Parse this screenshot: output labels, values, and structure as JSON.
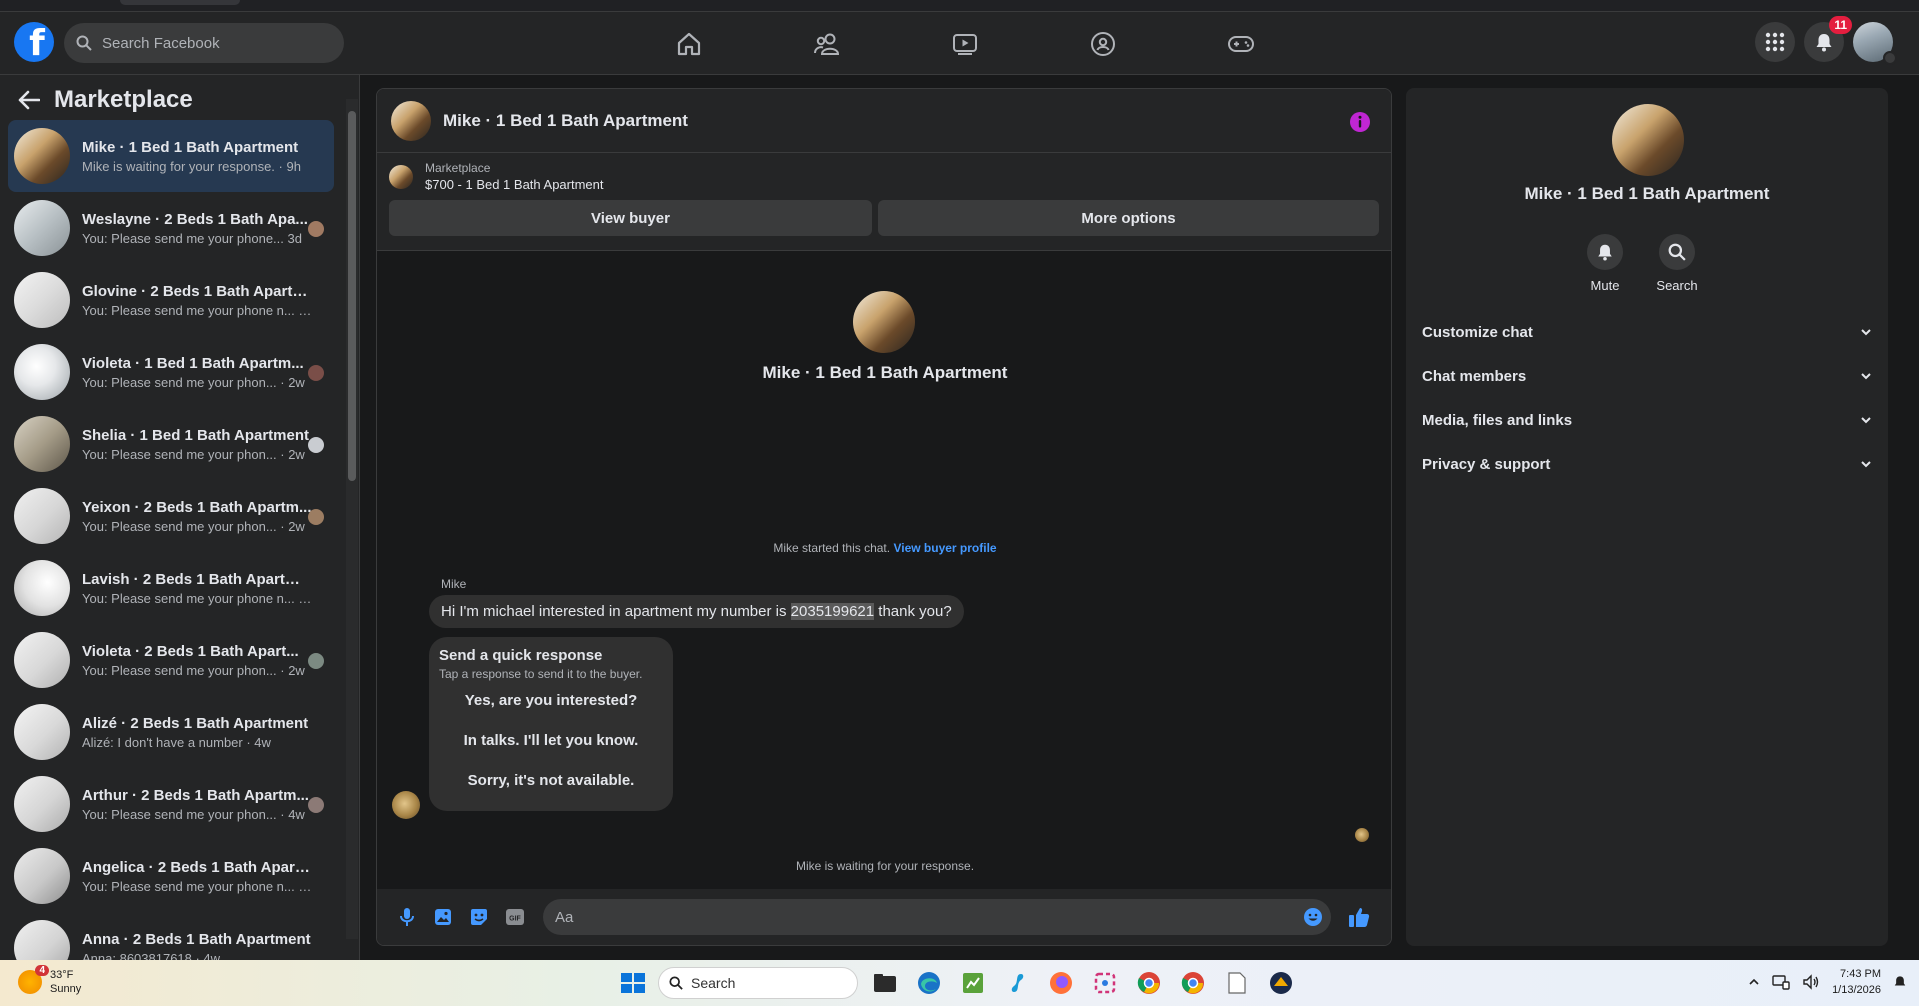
{
  "topnav": {
    "logo_letter": "f",
    "search_placeholder": "Search Facebook",
    "notifications_count": "11"
  },
  "sidebar": {
    "title": "Marketplace",
    "conversations": [
      {
        "title": "Mike · 1 Bed 1 Bath Apartment",
        "subtitle": "Mike is waiting for your response. · 9h",
        "active": true
      },
      {
        "title": "Weslayne · 2 Beds 1 Bath Apa...",
        "subtitle": "You: Please send me your phone... 3d"
      },
      {
        "title": "Glovine · 2 Beds 1 Bath Apartme...",
        "subtitle": "You: Please send me your phone n... · 2w"
      },
      {
        "title": "Violeta · 1 Bed 1 Bath Apartm...",
        "subtitle": "You: Please send me your phon... · 2w"
      },
      {
        "title": "Shelia · 1 Bed 1 Bath Apartment",
        "subtitle": "You: Please send me your phon... · 2w"
      },
      {
        "title": "Yeixon · 2 Beds 1 Bath Apartm...",
        "subtitle": "You: Please send me your phon... · 2w"
      },
      {
        "title": "Lavish · 2 Beds 1 Bath Apartment",
        "subtitle": "You: Please send me your phone n... · 2w"
      },
      {
        "title": "Violeta · 2 Beds 1 Bath Apart...",
        "subtitle": "You: Please send me your phon... · 2w"
      },
      {
        "title": "Alizé · 2 Beds 1 Bath Apartment",
        "subtitle": "Alizé: I don't have a number · 4w"
      },
      {
        "title": "Arthur · 2 Beds 1 Bath Apartm...",
        "subtitle": "You: Please send me your phon... · 4w"
      },
      {
        "title": "Angelica · 2 Beds 1 Bath Apartm...",
        "subtitle": "You: Please send me your phone n... · 4w"
      },
      {
        "title": "Anna · 2 Beds 1 Bath Apartment",
        "subtitle": "Anna: 8603817618 · 4w"
      }
    ]
  },
  "chat": {
    "header_name": "Mike · 1 Bed 1 Bath Apartment",
    "listing_category": "Marketplace",
    "listing_price": "$700 - 1 Bed 1 Bath Apartment",
    "view_buyer_label": "View buyer",
    "more_options_label": "More options",
    "intro_name": "Mike · 1 Bed 1 Bath Apartment",
    "started_text": "Mike started this chat.",
    "view_profile_link": "View buyer profile",
    "sender_name": "Mike",
    "message_before": "Hi I'm michael interested in apartment my number is ",
    "message_number": "2035199621",
    "message_after": "  thank you?",
    "quick_title": "Send a quick response",
    "quick_subtitle": "Tap a response to send it to the buyer.",
    "quick_options": [
      "Yes, are you interested?",
      "In talks. I'll let you know.",
      "Sorry, it's not available."
    ],
    "waiting_text": "Mike is waiting for your response.",
    "composer_placeholder": "Aa"
  },
  "right_panel": {
    "name": "Mike · 1 Bed 1 Bath Apartment",
    "mute_label": "Mute",
    "search_label": "Search",
    "sections": [
      "Customize chat",
      "Chat members",
      "Media, files and links",
      "Privacy & support"
    ]
  },
  "taskbar": {
    "weather_badge": "4",
    "temperature": "33°F",
    "condition": "Sunny",
    "search_label": "Search",
    "time": "7:43 PM",
    "date": "1/13/2026"
  },
  "colors": {
    "accent": "#1877f2",
    "link": "#4599ff",
    "info": "#c026d3",
    "active_row": "#263951"
  }
}
